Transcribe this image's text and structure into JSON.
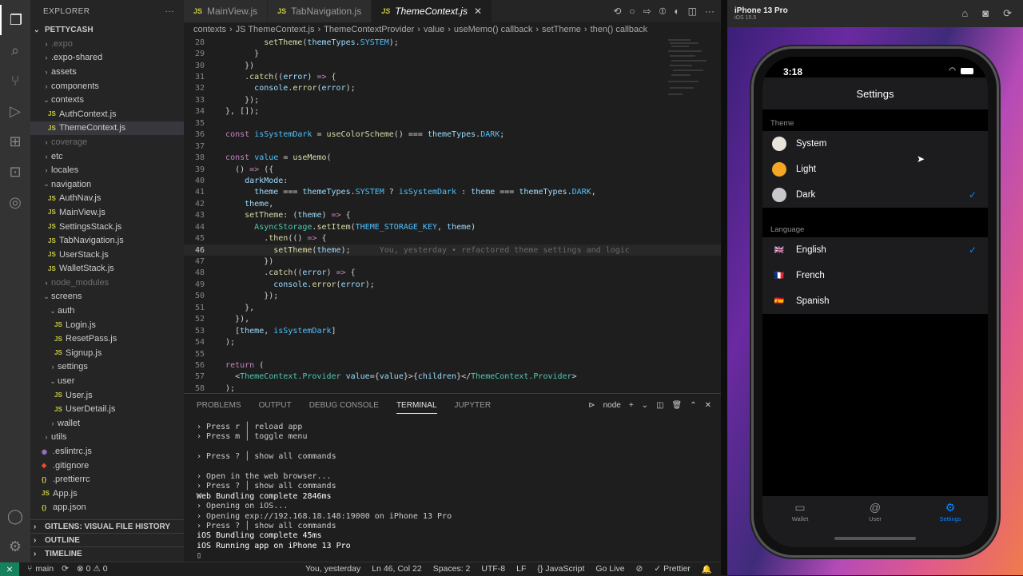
{
  "sidebar": {
    "header": "EXPLORER",
    "more": "···",
    "root": "PETTYCASH",
    "items": [
      {
        "label": ".expo",
        "type": "folder",
        "indent": 1,
        "dim": true,
        "open": false
      },
      {
        "label": ".expo-shared",
        "type": "folder",
        "indent": 1,
        "open": false
      },
      {
        "label": "assets",
        "type": "folder",
        "indent": 1,
        "open": false
      },
      {
        "label": "components",
        "type": "folder",
        "indent": 1,
        "open": false
      },
      {
        "label": "contexts",
        "type": "folder",
        "indent": 1,
        "open": true
      },
      {
        "label": "AuthContext.js",
        "type": "js",
        "indent": 2
      },
      {
        "label": "ThemeContext.js",
        "type": "js",
        "indent": 2,
        "selected": true
      },
      {
        "label": "coverage",
        "type": "folder",
        "indent": 1,
        "dim": true,
        "open": false
      },
      {
        "label": "etc",
        "type": "folder",
        "indent": 1,
        "open": false
      },
      {
        "label": "locales",
        "type": "folder",
        "indent": 1,
        "open": false
      },
      {
        "label": "navigation",
        "type": "folder",
        "indent": 1,
        "open": true
      },
      {
        "label": "AuthNav.js",
        "type": "js",
        "indent": 2
      },
      {
        "label": "MainView.js",
        "type": "js",
        "indent": 2
      },
      {
        "label": "SettingsStack.js",
        "type": "js",
        "indent": 2
      },
      {
        "label": "TabNavigation.js",
        "type": "js",
        "indent": 2
      },
      {
        "label": "UserStack.js",
        "type": "js",
        "indent": 2
      },
      {
        "label": "WalletStack.js",
        "type": "js",
        "indent": 2
      },
      {
        "label": "node_modules",
        "type": "folder",
        "indent": 1,
        "dim": true,
        "open": false
      },
      {
        "label": "screens",
        "type": "folder",
        "indent": 1,
        "open": true
      },
      {
        "label": "auth",
        "type": "folder",
        "indent": 2,
        "open": true
      },
      {
        "label": "Login.js",
        "type": "js",
        "indent": 3
      },
      {
        "label": "ResetPass.js",
        "type": "js",
        "indent": 3
      },
      {
        "label": "Signup.js",
        "type": "js",
        "indent": 3
      },
      {
        "label": "settings",
        "type": "folder",
        "indent": 2,
        "open": false
      },
      {
        "label": "user",
        "type": "folder",
        "indent": 2,
        "open": true
      },
      {
        "label": "User.js",
        "type": "js",
        "indent": 3
      },
      {
        "label": "UserDetail.js",
        "type": "js",
        "indent": 3
      },
      {
        "label": "wallet",
        "type": "folder",
        "indent": 2,
        "open": false
      },
      {
        "label": "utils",
        "type": "folder",
        "indent": 1,
        "open": false
      },
      {
        "label": ".eslintrc.js",
        "type": "eslint",
        "indent": 1
      },
      {
        "label": ".gitignore",
        "type": "git",
        "indent": 1
      },
      {
        "label": ".prettierrc",
        "type": "json",
        "indent": 1
      },
      {
        "label": "App.js",
        "type": "js",
        "indent": 1
      },
      {
        "label": "app.json",
        "type": "json",
        "indent": 1
      }
    ],
    "sections": [
      "GITLENS: VISUAL FILE HISTORY",
      "OUTLINE",
      "TIMELINE"
    ]
  },
  "tabs": [
    {
      "label": "MainView.js",
      "active": false
    },
    {
      "label": "TabNavigation.js",
      "active": false
    },
    {
      "label": "ThemeContext.js",
      "active": true
    }
  ],
  "breadcrumb": [
    "contexts",
    "JS ThemeContext.js",
    "ThemeContextProvider",
    "value",
    "useMemo() callback",
    "setTheme",
    "then() callback"
  ],
  "code": {
    "lines": [
      {
        "n": "28",
        "html": "          <span class=\"f\">setTheme</span>(<span class=\"v\">themeTypes</span>.<span class=\"c\">SYSTEM</span>);"
      },
      {
        "n": "29",
        "html": "        }"
      },
      {
        "n": "30",
        "html": "      })"
      },
      {
        "n": "31",
        "html": "      .<span class=\"f\">catch</span>((<span class=\"v\">error</span>) <span class=\"k\">=&gt;</span> {"
      },
      {
        "n": "32",
        "html": "        <span class=\"v\">console</span>.<span class=\"f\">error</span>(<span class=\"v\">error</span>);"
      },
      {
        "n": "33",
        "html": "      });"
      },
      {
        "n": "34",
        "html": "  }, []);"
      },
      {
        "n": "35",
        "html": ""
      },
      {
        "n": "36",
        "html": "  <span class=\"k\">const</span> <span class=\"c\">isSystemDark</span> = <span class=\"f\">useColorScheme</span>() === <span class=\"v\">themeTypes</span>.<span class=\"c\">DARK</span>;"
      },
      {
        "n": "37",
        "html": ""
      },
      {
        "n": "38",
        "html": "  <span class=\"k\">const</span> <span class=\"c\">value</span> = <span class=\"f\">useMemo</span>("
      },
      {
        "n": "39",
        "html": "    () <span class=\"k\">=&gt;</span> ({"
      },
      {
        "n": "40",
        "html": "      <span class=\"v\">darkMode</span>:"
      },
      {
        "n": "41",
        "html": "        <span class=\"v\">theme</span> === <span class=\"v\">themeTypes</span>.<span class=\"c\">SYSTEM</span> ? <span class=\"c\">isSystemDark</span> : <span class=\"v\">theme</span> === <span class=\"v\">themeTypes</span>.<span class=\"c\">DARK</span>,"
      },
      {
        "n": "42",
        "html": "      <span class=\"v\">theme</span>,"
      },
      {
        "n": "43",
        "html": "      <span class=\"f\">setTheme</span>: (<span class=\"v\">theme</span>) <span class=\"k\">=&gt;</span> {"
      },
      {
        "n": "44",
        "html": "        <span class=\"t\">AsyncStorage</span>.<span class=\"f\">setItem</span>(<span class=\"c\">THEME_STORAGE_KEY</span>, <span class=\"v\">theme</span>)"
      },
      {
        "n": "45",
        "html": "          .<span class=\"f\">then</span>(() <span class=\"k\">=&gt;</span> {"
      },
      {
        "n": "46",
        "html": "            <span class=\"f\">setTheme</span>(<span class=\"v\">theme</span>);      <span class=\"g\">You, yesterday • refactored theme settings and logic</span>",
        "current": true
      },
      {
        "n": "47",
        "html": "          })"
      },
      {
        "n": "48",
        "html": "          .<span class=\"f\">catch</span>((<span class=\"v\">error</span>) <span class=\"k\">=&gt;</span> {"
      },
      {
        "n": "49",
        "html": "            <span class=\"v\">console</span>.<span class=\"f\">error</span>(<span class=\"v\">error</span>);"
      },
      {
        "n": "50",
        "html": "          });"
      },
      {
        "n": "51",
        "html": "      },"
      },
      {
        "n": "52",
        "html": "    }),"
      },
      {
        "n": "53",
        "html": "    [<span class=\"v\">theme</span>, <span class=\"c\">isSystemDark</span>]"
      },
      {
        "n": "54",
        "html": "  );"
      },
      {
        "n": "55",
        "html": ""
      },
      {
        "n": "56",
        "html": "  <span class=\"k\">return</span> ("
      },
      {
        "n": "57",
        "html": "    &lt;<span class=\"t\">ThemeContext.Provider</span> <span class=\"v\">value</span>={<span class=\"v\">value</span>}&gt;{<span class=\"v\">children</span>}&lt;/<span class=\"t\">ThemeContext.Provider</span>&gt;"
      },
      {
        "n": "58",
        "html": "  );"
      },
      {
        "n": "59",
        "html": "}"
      }
    ]
  },
  "panel": {
    "tabs": [
      "PROBLEMS",
      "OUTPUT",
      "DEBUG CONSOLE",
      "TERMINAL",
      "JUPYTER"
    ],
    "active_tab": "TERMINAL",
    "shell": "node",
    "terminal_lines": [
      "› Press r │ reload app",
      "› Press m │ toggle menu",
      "",
      "› Press ? │ show all commands",
      "",
      "› Open in the web browser...",
      "› Press ? │ show all commands",
      "Web Bundling complete 2846ms",
      "› Opening on iOS...",
      "› Opening exp://192.168.18.148:19000 on iPhone 13 Pro",
      "› Press ? │ show all commands",
      "iOS Bundling complete 45ms",
      "iOS Running app on iPhone 13 Pro"
    ]
  },
  "statusbar": {
    "remote": "⨯",
    "branch": "main",
    "sync": "⟳",
    "problems": "⊗ 0 ⚠ 0",
    "blame": "You, yesterday",
    "position": "Ln 46, Col 22",
    "spaces": "Spaces: 2",
    "encoding": "UTF-8",
    "eol": "LF",
    "language": "{} JavaScript",
    "golive": "Go Live",
    "prettier": "✓ Prettier"
  },
  "simulator": {
    "device": "iPhone 13 Pro",
    "os": "iOS 15.5",
    "time": "3:18",
    "nav_title": "Settings",
    "theme_label": "Theme",
    "theme_options": [
      {
        "label": "System",
        "checked": false,
        "color": "#e9e4d8"
      },
      {
        "label": "Light",
        "checked": false,
        "color": "#f5a623"
      },
      {
        "label": "Dark",
        "checked": true,
        "color": "#c7c7cc"
      }
    ],
    "language_label": "Language",
    "language_options": [
      {
        "label": "English",
        "checked": true,
        "flag": "🇬🇧"
      },
      {
        "label": "French",
        "checked": false,
        "flag": "🇫🇷"
      },
      {
        "label": "Spanish",
        "checked": false,
        "flag": "🇪🇸"
      }
    ],
    "check": "✓",
    "tabbar": [
      {
        "label": "Wallet",
        "icon": "wallet-icon",
        "active": false
      },
      {
        "label": "User",
        "icon": "at-icon",
        "active": false
      },
      {
        "label": "Settings",
        "icon": "gear-icon",
        "active": true
      }
    ],
    "accent": "#0a84ff"
  }
}
